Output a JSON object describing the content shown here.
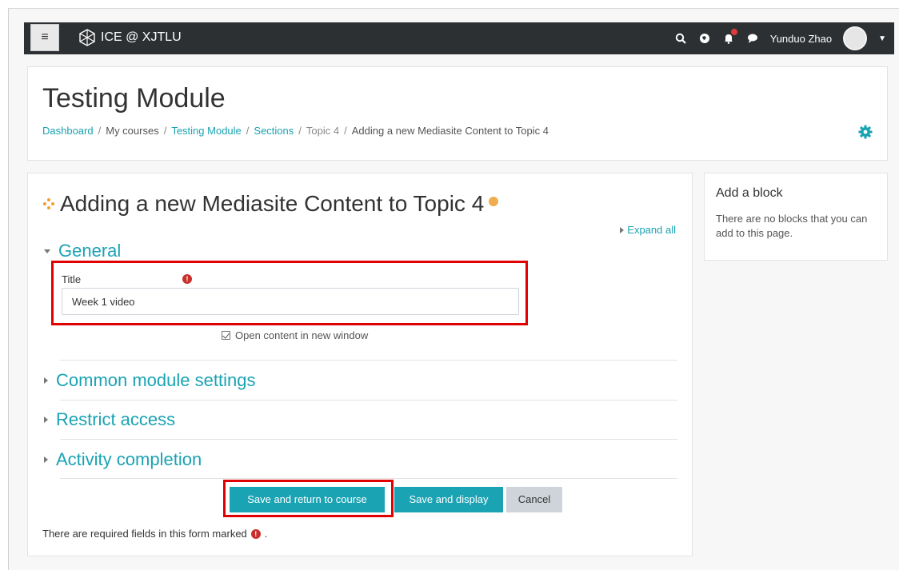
{
  "navbar": {
    "brand": "ICE @ XJTLU",
    "user_name": "Yunduo Zhao"
  },
  "header": {
    "title": "Testing Module",
    "breadcrumb": [
      "Dashboard",
      "My courses",
      "Testing Module",
      "Sections",
      "Topic 4",
      "Adding a new Mediasite Content to Topic 4"
    ]
  },
  "form": {
    "title": "Adding a new Mediasite Content to Topic 4",
    "expand_all": "Expand all",
    "general": "General",
    "title_label": "Title",
    "title_value": "Week 1 video",
    "open_new_window": "Open content in new window",
    "sections": [
      "Common module settings",
      "Restrict access",
      "Activity completion"
    ],
    "buttons": {
      "save_return": "Save and return to course",
      "save_display": "Save and display",
      "cancel": "Cancel"
    },
    "required_note": "There are required fields in this form marked",
    "required_note_end": "."
  },
  "block": {
    "title": "Add a block",
    "text": "There are no blocks that you can add to this page."
  },
  "colors": {
    "accent": "#1aa3b3",
    "navbar": "#2d3033",
    "highlight": "#e00000"
  },
  "icons": {
    "menu": "hamburger-icon",
    "logo": "xjtlu-logo-icon",
    "search": "search-icon",
    "globe": "globe-icon",
    "notifications": "bell-icon",
    "messages": "chat-icon",
    "settings": "gear-icon"
  }
}
